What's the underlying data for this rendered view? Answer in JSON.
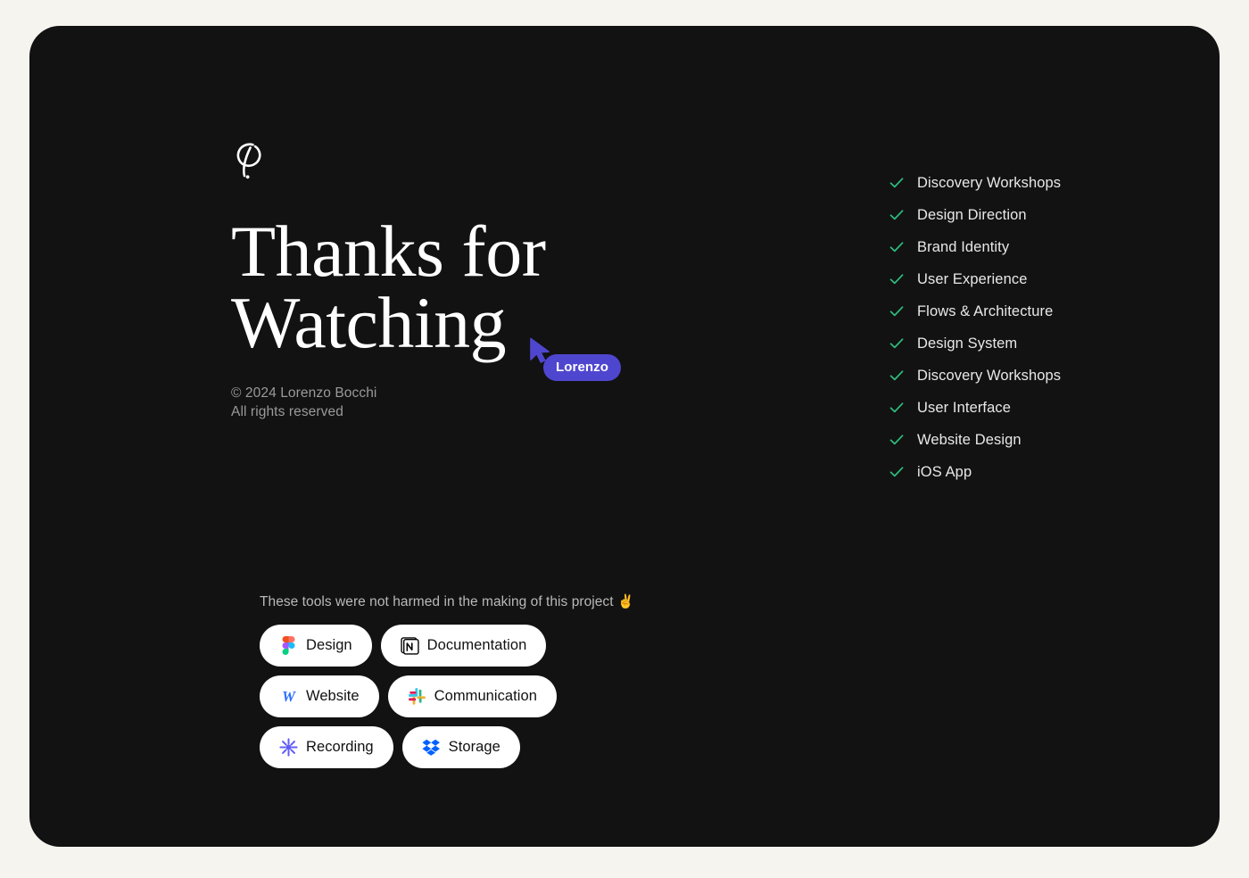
{
  "theme": {
    "page_background": "#F5F4EF",
    "card_background": "#121212",
    "heading_color": "#FFFFFF",
    "muted_text_color": "#9A9A9A",
    "check_green": "#2EBD7E",
    "cursor_purple": "#4F46CF",
    "pill_background": "#FFFFFF",
    "pill_text": "#111111"
  },
  "brand": {
    "logo_name": "lorenzo-bocchi-monogram"
  },
  "hero": {
    "headline_line_1": "Thanks for",
    "headline_line_2": "Watching",
    "copyright_line_1": "© 2024 Lorenzo Bocchi",
    "copyright_line_2": "All rights reserved"
  },
  "cursor": {
    "label": "Lorenzo",
    "icon": "cursor-arrow-icon"
  },
  "checklist": {
    "items": [
      {
        "label": "Discovery Workshops",
        "icon": "check-icon"
      },
      {
        "label": "Design Direction",
        "icon": "check-icon"
      },
      {
        "label": "Brand Identity",
        "icon": "check-icon"
      },
      {
        "label": "User Experience",
        "icon": "check-icon"
      },
      {
        "label": "Flows & Architecture",
        "icon": "check-icon"
      },
      {
        "label": "Design System",
        "icon": "check-icon"
      },
      {
        "label": "Discovery Workshops",
        "icon": "check-icon"
      },
      {
        "label": "User Interface",
        "icon": "check-icon"
      },
      {
        "label": "Website Design",
        "icon": "check-icon"
      },
      {
        "label": "iOS App",
        "icon": "check-icon"
      }
    ]
  },
  "tools": {
    "caption": "These tools were not harmed in the making of this project",
    "caption_emoji": "✌️",
    "items": [
      {
        "label": "Design",
        "icon": "figma-icon"
      },
      {
        "label": "Documentation",
        "icon": "notion-icon"
      },
      {
        "label": "Website",
        "icon": "webflow-icon"
      },
      {
        "label": "Communication",
        "icon": "slack-icon"
      },
      {
        "label": "Recording",
        "icon": "loom-icon"
      },
      {
        "label": "Storage",
        "icon": "dropbox-icon"
      }
    ]
  }
}
